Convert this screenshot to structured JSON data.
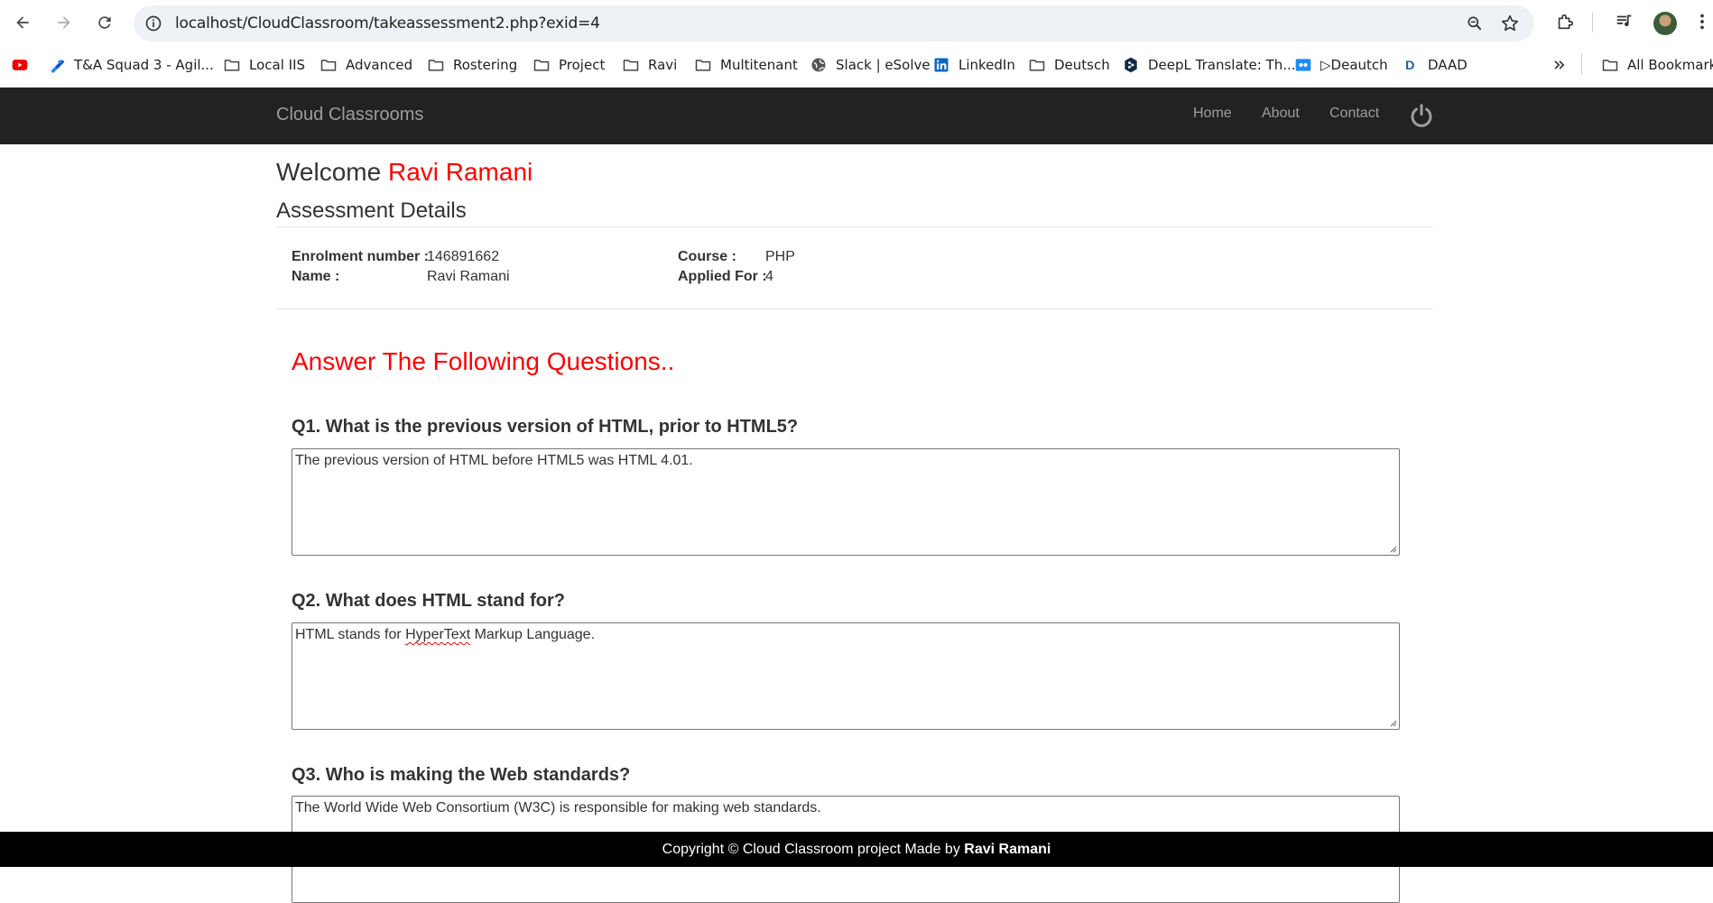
{
  "browser": {
    "url": "localhost/CloudClassroom/takeassessment2.php?exid=4",
    "bookmarks": [
      {
        "label": "T&A Squad 3 - Agil...",
        "icon": "jira-icon"
      },
      {
        "label": "Local IIS",
        "icon": "folder-icon"
      },
      {
        "label": "Advanced",
        "icon": "folder-icon"
      },
      {
        "label": "Rostering",
        "icon": "folder-icon"
      },
      {
        "label": "Project",
        "icon": "folder-icon"
      },
      {
        "label": "Ravi",
        "icon": "folder-icon"
      },
      {
        "label": "Multitenant",
        "icon": "folder-icon"
      },
      {
        "label": "Slack | eSolve",
        "icon": "globe-icon"
      },
      {
        "label": "LinkedIn",
        "icon": "linkedin-icon"
      },
      {
        "label": "Deutsch",
        "icon": "folder-icon"
      },
      {
        "label": "DeepL Translate: Th...",
        "icon": "deepl-icon"
      },
      {
        "label": "▷Deautch",
        "icon": "video-icon"
      },
      {
        "label": "DAAD",
        "icon": "daad-icon"
      }
    ],
    "all_bookmarks": "All Bookmarks"
  },
  "navbar": {
    "brand": "Cloud Classrooms",
    "links": [
      "Home",
      "About",
      "Contact"
    ]
  },
  "welcome": {
    "prefix": "Welcome ",
    "user": "Ravi Ramani"
  },
  "assessment": {
    "title": "Assessment Details",
    "enrolment_label": "Enrolment number :",
    "enrolment_value": "146891662",
    "name_label": "Name :",
    "name_value": "Ravi Ramani",
    "course_label": "Course :",
    "course_value": "PHP",
    "applied_label": "Applied For :",
    "applied_value": "4"
  },
  "answer_heading": "Answer The Following Questions..",
  "questions": [
    {
      "q": "Q1. What is the previous version of HTML, prior to HTML5?",
      "a": "The previous version of HTML before HTML5 was HTML 4.01."
    },
    {
      "q": "Q2. What does HTML stand for?",
      "a_pre": "HTML stands for ",
      "a_spell": "HyperText",
      "a_post": " Markup Language."
    },
    {
      "q": "Q3. Who is making the Web standards?",
      "a": "The World Wide Web Consortium (W3C) is responsible for making web standards."
    }
  ],
  "footer": {
    "text": "Copyright © Cloud Classroom project Made by ",
    "author": "Ravi Ramani"
  },
  "colors": {
    "navbar_bg": "#222222",
    "accent_red": "#ff0000",
    "footer_bg": "#000000"
  }
}
